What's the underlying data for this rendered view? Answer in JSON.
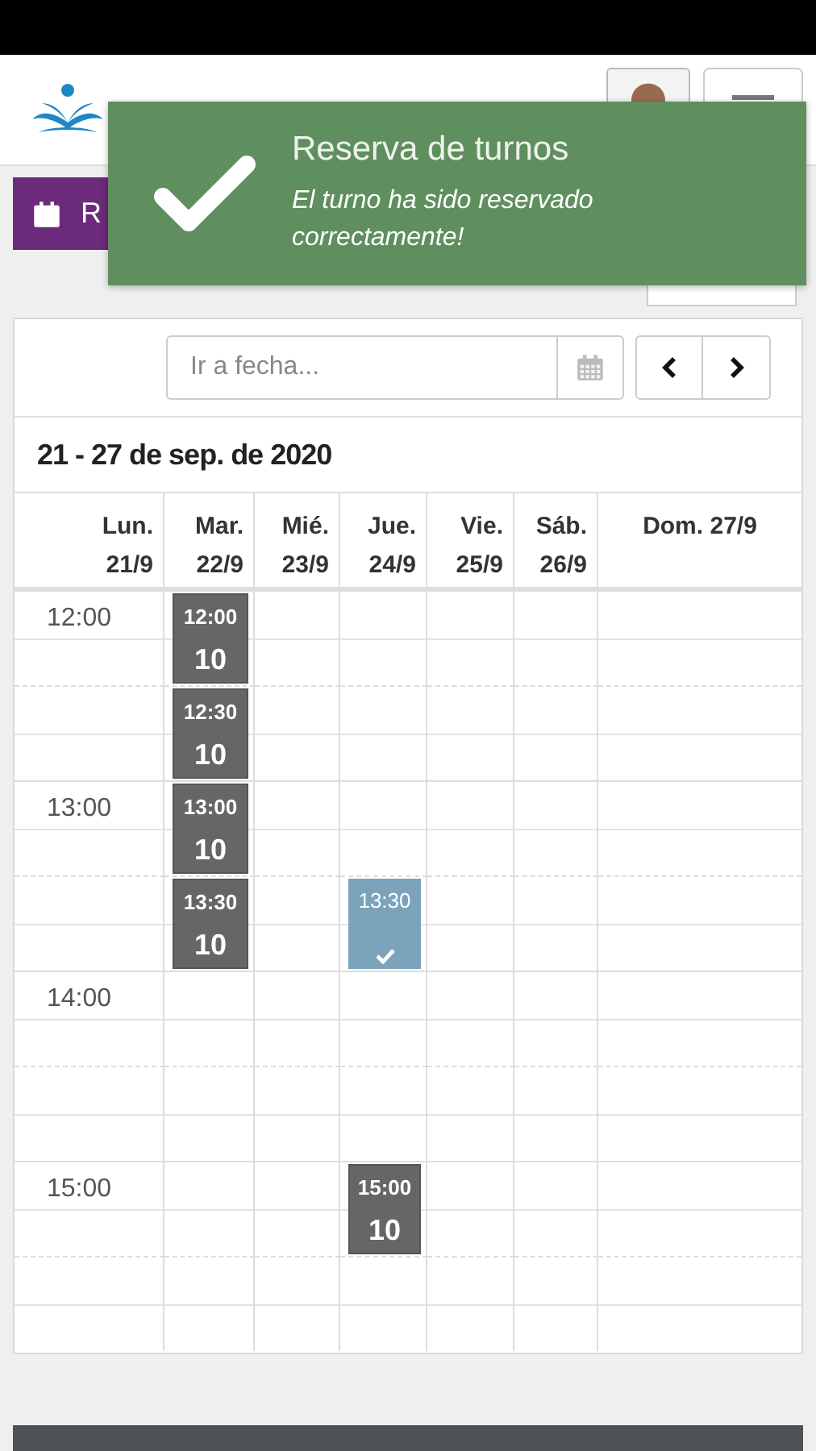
{
  "action_button": {
    "label": "R"
  },
  "toast": {
    "title": "Reserva de turnos",
    "message": "El turno ha sido reservado correctamente!"
  },
  "date_field": {
    "placeholder": "Ir a fecha..."
  },
  "nav_buttons": [
    {
      "kind": "prev"
    },
    {
      "kind": "next"
    }
  ],
  "range_title": "21 - 27 de sep. de 2020",
  "days": [
    {
      "name": "Lun.",
      "date": "21/9"
    },
    {
      "name": "Mar.",
      "date": "22/9"
    },
    {
      "name": "Mié.",
      "date": "23/9"
    },
    {
      "name": "Jue.",
      "date": "24/9"
    },
    {
      "name": "Vie.",
      "date": "25/9"
    },
    {
      "name": "Sáb.",
      "date": "26/9"
    },
    {
      "name": "Dom.",
      "date": "27/9"
    }
  ],
  "rows": [
    {
      "label": "12:00",
      "cells": [
        {
          "kind": "available",
          "time": "12:00",
          "count": "10"
        },
        {
          "kind": "empty"
        },
        {
          "kind": "empty"
        },
        {
          "kind": "empty"
        },
        {
          "kind": "empty"
        },
        {
          "kind": "empty"
        }
      ]
    },
    {
      "cells": [
        {
          "kind": "available",
          "time": "12:30",
          "count": "10"
        },
        {
          "kind": "empty"
        },
        {
          "kind": "empty"
        },
        {
          "kind": "empty"
        },
        {
          "kind": "empty"
        },
        {
          "kind": "empty"
        }
      ]
    },
    {
      "label": "13:00",
      "cells": [
        {
          "kind": "available",
          "time": "13:00",
          "count": "10"
        },
        {
          "kind": "empty"
        },
        {
          "kind": "empty"
        },
        {
          "kind": "empty"
        },
        {
          "kind": "empty"
        },
        {
          "kind": "empty"
        }
      ]
    },
    {
      "cells": [
        {
          "kind": "available",
          "time": "13:30",
          "count": "10"
        },
        {
          "kind": "empty"
        },
        {
          "kind": "booked",
          "time": "13:30"
        },
        {
          "kind": "empty"
        },
        {
          "kind": "empty"
        },
        {
          "kind": "empty"
        }
      ]
    },
    {
      "label": "14:00",
      "cells": [
        {
          "kind": "empty"
        },
        {
          "kind": "empty"
        },
        {
          "kind": "empty"
        },
        {
          "kind": "empty"
        },
        {
          "kind": "empty"
        },
        {
          "kind": "empty"
        }
      ]
    },
    {
      "cells": [
        {
          "kind": "empty"
        },
        {
          "kind": "empty"
        },
        {
          "kind": "empty"
        },
        {
          "kind": "empty"
        },
        {
          "kind": "empty"
        },
        {
          "kind": "empty"
        }
      ]
    },
    {
      "label": "15:00",
      "cells": [
        {
          "kind": "empty"
        },
        {
          "kind": "empty"
        },
        {
          "kind": "available",
          "time": "15:00",
          "count": "10"
        },
        {
          "kind": "empty"
        },
        {
          "kind": "empty"
        },
        {
          "kind": "empty"
        }
      ]
    },
    {
      "cells": [
        {
          "kind": "empty"
        },
        {
          "kind": "empty"
        },
        {
          "kind": "empty"
        },
        {
          "kind": "empty"
        },
        {
          "kind": "empty"
        },
        {
          "kind": "empty"
        }
      ]
    }
  ]
}
